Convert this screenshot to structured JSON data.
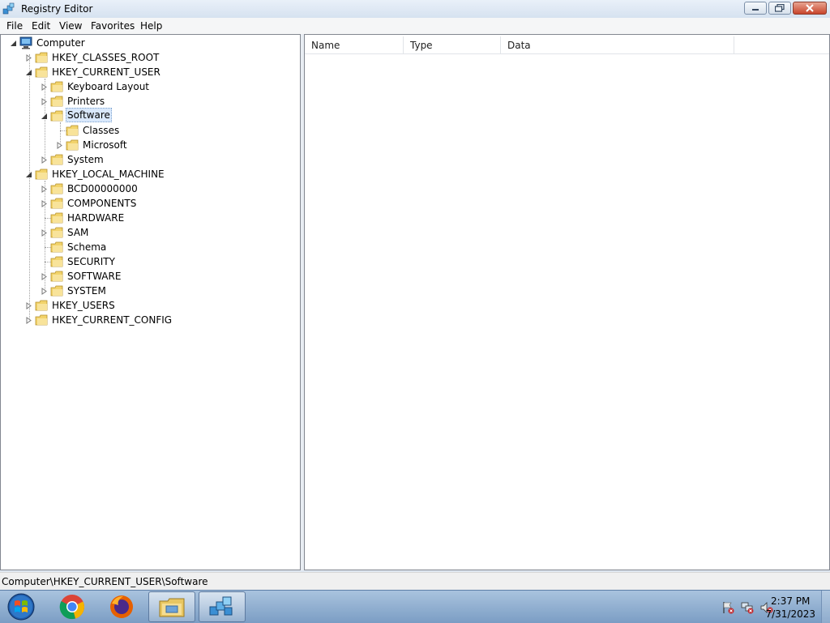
{
  "window": {
    "title": "Registry Editor",
    "icon": "regedit-icon"
  },
  "menubar": {
    "items": [
      {
        "label": "File"
      },
      {
        "label": "Edit"
      },
      {
        "label": "View"
      },
      {
        "label": "Favorites"
      },
      {
        "label": "Help"
      }
    ]
  },
  "tree": {
    "root": "Computer",
    "nodes": [
      {
        "label": "HKEY_CLASSES_ROOT",
        "state": "collapsed"
      },
      {
        "label": "HKEY_CURRENT_USER",
        "state": "expanded"
      },
      {
        "label": "Keyboard Layout",
        "state": "collapsed"
      },
      {
        "label": "Printers",
        "state": "collapsed"
      },
      {
        "label": "Software",
        "state": "expanded",
        "selected": true
      },
      {
        "label": "Classes",
        "state": "leaf"
      },
      {
        "label": "Microsoft",
        "state": "collapsed"
      },
      {
        "label": "System",
        "state": "collapsed"
      },
      {
        "label": "HKEY_LOCAL_MACHINE",
        "state": "expanded"
      },
      {
        "label": "BCD00000000",
        "state": "collapsed"
      },
      {
        "label": "COMPONENTS",
        "state": "collapsed"
      },
      {
        "label": "HARDWARE",
        "state": "leaf"
      },
      {
        "label": "SAM",
        "state": "collapsed"
      },
      {
        "label": "Schema",
        "state": "leaf"
      },
      {
        "label": "SECURITY",
        "state": "leaf"
      },
      {
        "label": "SOFTWARE",
        "state": "collapsed"
      },
      {
        "label": "SYSTEM",
        "state": "collapsed"
      },
      {
        "label": "HKEY_USERS",
        "state": "collapsed"
      },
      {
        "label": "HKEY_CURRENT_CONFIG",
        "state": "collapsed"
      }
    ]
  },
  "list": {
    "columns": [
      {
        "label": "Name"
      },
      {
        "label": "Type"
      },
      {
        "label": "Data"
      }
    ],
    "rows": []
  },
  "statusbar": {
    "path": "Computer\\HKEY_CURRENT_USER\\Software"
  },
  "taskbar": {
    "items": [
      {
        "name": "chrome-icon"
      },
      {
        "name": "firefox-icon"
      },
      {
        "name": "file-explorer-icon"
      },
      {
        "name": "regedit-icon"
      }
    ],
    "clock": {
      "time": "2:37 PM",
      "date": "7/31/2023"
    }
  },
  "colors": {
    "selection": "#d9e8fb",
    "folder": "#f2d36b",
    "taskbar": "#8fb0d6"
  }
}
